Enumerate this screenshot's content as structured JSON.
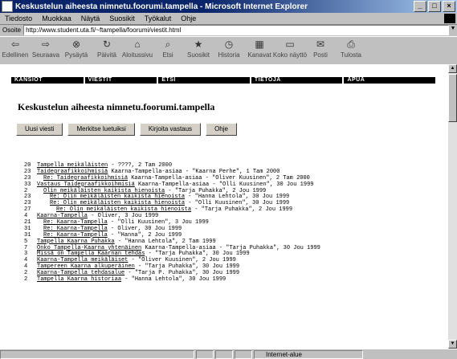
{
  "window": {
    "title": "Keskustelun aiheesta nimnetu.foorumi.tampella - Microsoft Internet Explorer",
    "controls": [
      "_",
      "□",
      "×"
    ]
  },
  "menu": [
    "Tiedosto",
    "Muokkaa",
    "Näytä",
    "Suosikit",
    "Työkalut",
    "Ohje"
  ],
  "address": {
    "label": "Osoite",
    "url": "http://www.student.uta.fi/~ftampella/foorumi/viestit.html"
  },
  "toolbar": [
    {
      "label": "Edellinen",
      "icon": "⇦"
    },
    {
      "label": "Seuraava",
      "icon": "⇨"
    },
    {
      "label": "Pysäytä",
      "icon": "⊗"
    },
    {
      "label": "Päivitä",
      "icon": "↻"
    },
    {
      "label": "Aloitussivu",
      "icon": "⌂"
    },
    {
      "label": "Etsi",
      "icon": "⌕"
    },
    {
      "label": "Suosikit",
      "icon": "★"
    },
    {
      "label": "Historia",
      "icon": "◷"
    },
    {
      "label": "Kanavat",
      "icon": "▦"
    },
    {
      "label": "Koko näyttö",
      "icon": "▭"
    },
    {
      "label": "Posti",
      "icon": "✉"
    },
    {
      "label": "Tulosta",
      "icon": "⎙"
    }
  ],
  "forum_nav": [
    "KANSIOT",
    "VIESTIT",
    "ETSI",
    "TIETOJA",
    "APUA"
  ],
  "page_title": "Keskustelun aiheesta nimnetu.foorumi.tampella",
  "buttons": [
    "Uusi viesti",
    "Merkitse luetuiksi",
    "Kirjoita vastaus",
    "Ohje"
  ],
  "threads": [
    {
      "num": "20",
      "indent": 0,
      "link": "Tampella meikäläisten",
      "rest": " - ????, 2 Tam 2000"
    },
    {
      "num": "23",
      "indent": 0,
      "link": "Taidegraafikkoihmisiä",
      "rest": " Kaarna-Tampella-asiaa - \"Kaarna Perhe\", 1 Tam 2000"
    },
    {
      "num": "23",
      "indent": 1,
      "link": "Re: Taidegraafikkoihmisiä",
      "rest": " Kaarna-Tampella-asiaa - \"Oliver Kuusinen\", 2 Tam 2000"
    },
    {
      "num": "33",
      "indent": 0,
      "link": "Vastaus Taidegraafikkoihmisiä",
      "rest": " Kaarna-Tampella-asiaa - \"Olli Kuusinen\", 30 Jou 1999"
    },
    {
      "num": "2",
      "indent": 1,
      "link": "Olin meikäläisten kaikista hienoista",
      "rest": " - \"Tarja Puhakka\", 2 Jou 1999"
    },
    {
      "num": "23",
      "indent": 2,
      "link": "Re: Olin meikäläisten kaikista hienoista",
      "rest": " - \"Hanna Lehtola\", 30 Jou 1999"
    },
    {
      "num": "23",
      "indent": 2,
      "link": "Re: Olin meikäläisten kaikista hienoista",
      "rest": " - \"Olli Kuusinen\", 30 Jou 1999"
    },
    {
      "num": "27",
      "indent": 3,
      "link": "Re: Olin meikäläisten kaikista hienoista",
      "rest": " - \"Tarja Puhakka\", 2 Jou 1999"
    },
    {
      "num": "4",
      "indent": 0,
      "link": "Kaarna-Tampella",
      "rest": " - Oliver, 3 Jou 1999"
    },
    {
      "num": "21",
      "indent": 1,
      "link": "Re: Kaarna-Tampella",
      "rest": " - \"Olli Kuusinen\", 3 Jou 1999"
    },
    {
      "num": "31",
      "indent": 1,
      "link": "Re: Kaarna-Tampella",
      "rest": " - Oliver, 30 Jou 1999"
    },
    {
      "num": "31",
      "indent": 1,
      "link": "Re: Kaarna-Tampella",
      "rest": " - \"Hanna\", 2 Jou 1999"
    },
    {
      "num": "5",
      "indent": 0,
      "link": "Tampella Kaarna Puhakka",
      "rest": " - \"Hanna Lehtola\", 2 Tam 1999"
    },
    {
      "num": "7",
      "indent": 0,
      "link": "Onko Tampella-Kaarna yhtenäinen",
      "rest": " Kaarna-Tampella-asiaa - \"Tarja Puhakka\", 30 Jou 1999"
    },
    {
      "num": "3",
      "indent": 0,
      "link": "Missä on Tampella Kaarnan tehdas",
      "rest": " - \"Tarja Puhakka\", 30 Jou 1999"
    },
    {
      "num": "4",
      "indent": 0,
      "link": "Kaarna-Tampella meikäläiset",
      "rest": " - \"Oliver Kuusinen\", 2 Jou 1999"
    },
    {
      "num": "4",
      "indent": 0,
      "link": "Tampereen Kaarna alkuperäinen",
      "rest": " - \"Tarja Puhakka\", 30 Jou 1999"
    },
    {
      "num": "2",
      "indent": 0,
      "link": "Kaarna-Tampella tehdasalue",
      "rest": " - \"Tarja P. Puhakka\", 30 Jou 1999"
    },
    {
      "num": "2",
      "indent": 0,
      "link": "Tampella Kaarna historiaa",
      "rest": " - \"Hanna Lehtola\", 30 Jou 1999"
    }
  ],
  "status": {
    "zone": "Internet-alue"
  }
}
